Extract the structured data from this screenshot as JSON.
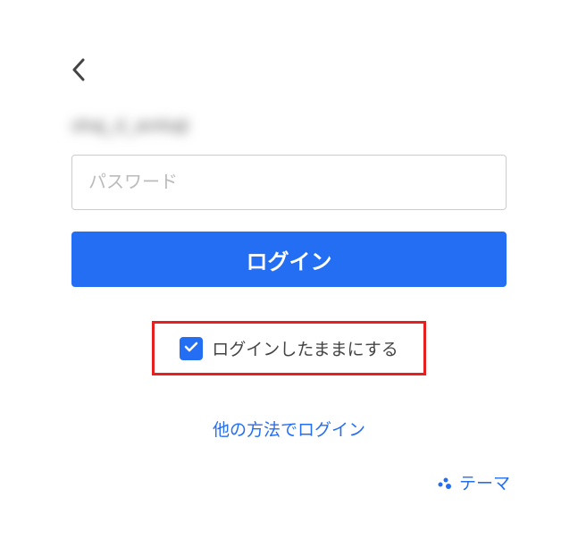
{
  "email_display": "ohaj_d_anrkajt",
  "password": {
    "placeholder": "パスワード",
    "value": ""
  },
  "login_button_label": "ログイン",
  "keep_logged_in": {
    "checked": true,
    "label": "ログインしたままにする"
  },
  "other_login_label": "他の方法でログイン",
  "theme_label": "テーマ",
  "colors": {
    "accent": "#246ef3",
    "highlight_border": "#e62020"
  }
}
